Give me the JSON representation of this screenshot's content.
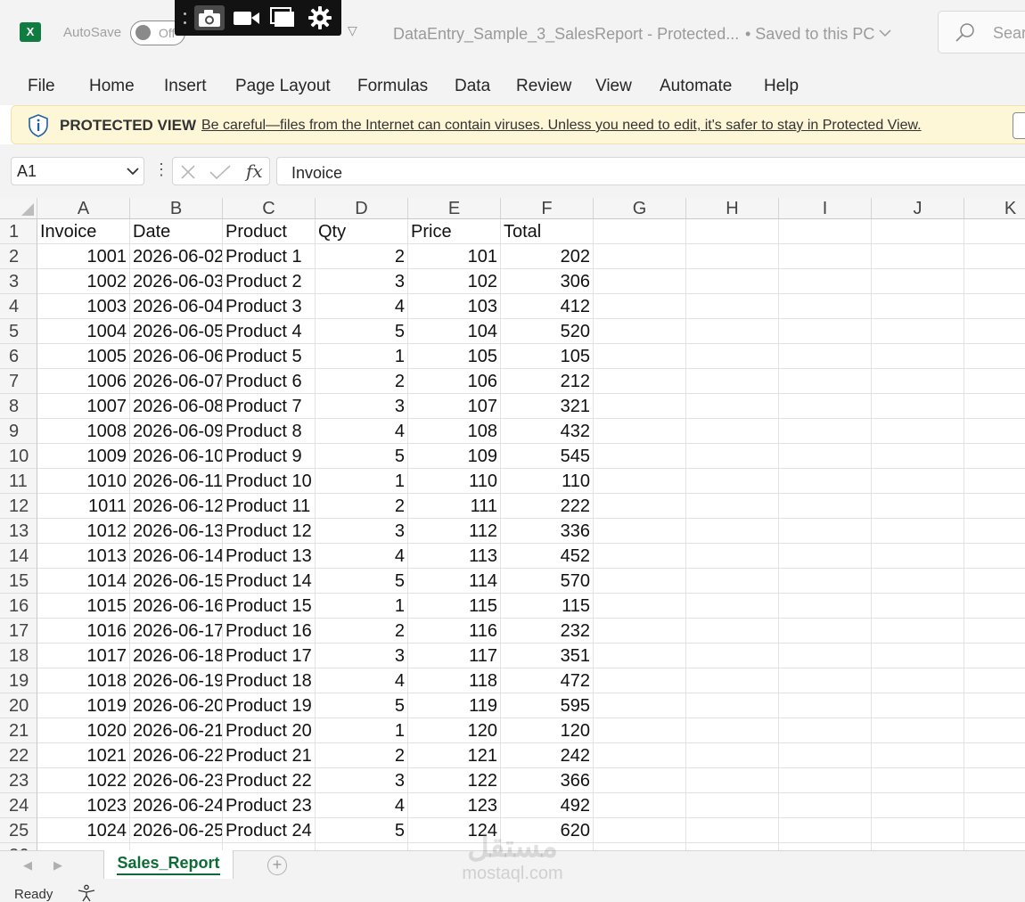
{
  "title_bar": {
    "app_logo_letter": "X",
    "autosave_label": "AutoSave",
    "autosave_state": "Off",
    "document_title": "DataEntry_Sample_3_SalesReport  -  Protected...",
    "save_status": "• Saved to this PC",
    "search_placeholder": "Search"
  },
  "menu": [
    "File",
    "Home",
    "Insert",
    "Page Layout",
    "Formulas",
    "Data",
    "Review",
    "View",
    "Automate",
    "Help"
  ],
  "protected_view": {
    "title": "PROTECTED VIEW",
    "message": "Be careful—files from the Internet can contain viruses. Unless you need to edit, it's safer to stay in Protected View."
  },
  "formula_bar": {
    "name_box": "A1",
    "fx_label": "fx",
    "formula": "Invoice"
  },
  "grid": {
    "columns": [
      "A",
      "B",
      "C",
      "D",
      "E",
      "F",
      "G",
      "H",
      "I",
      "J",
      "K"
    ],
    "header_row": [
      "Invoice",
      "Date",
      "Product",
      "Qty",
      "Price",
      "Total"
    ],
    "rows": [
      [
        "1001",
        "2026-06-02",
        "Product 1",
        "2",
        "101",
        "202"
      ],
      [
        "1002",
        "2026-06-03",
        "Product 2",
        "3",
        "102",
        "306"
      ],
      [
        "1003",
        "2026-06-04",
        "Product 3",
        "4",
        "103",
        "412"
      ],
      [
        "1004",
        "2026-06-05",
        "Product 4",
        "5",
        "104",
        "520"
      ],
      [
        "1005",
        "2026-06-06",
        "Product 5",
        "1",
        "105",
        "105"
      ],
      [
        "1006",
        "2026-06-07",
        "Product 6",
        "2",
        "106",
        "212"
      ],
      [
        "1007",
        "2026-06-08",
        "Product 7",
        "3",
        "107",
        "321"
      ],
      [
        "1008",
        "2026-06-09",
        "Product 8",
        "4",
        "108",
        "432"
      ],
      [
        "1009",
        "2026-06-10",
        "Product 9",
        "5",
        "109",
        "545"
      ],
      [
        "1010",
        "2026-06-11",
        "Product 10",
        "1",
        "110",
        "110"
      ],
      [
        "1011",
        "2026-06-12",
        "Product 11",
        "2",
        "111",
        "222"
      ],
      [
        "1012",
        "2026-06-13",
        "Product 12",
        "3",
        "112",
        "336"
      ],
      [
        "1013",
        "2026-06-14",
        "Product 13",
        "4",
        "113",
        "452"
      ],
      [
        "1014",
        "2026-06-15",
        "Product 14",
        "5",
        "114",
        "570"
      ],
      [
        "1015",
        "2026-06-16",
        "Product 15",
        "1",
        "115",
        "115"
      ],
      [
        "1016",
        "2026-06-17",
        "Product 16",
        "2",
        "116",
        "232"
      ],
      [
        "1017",
        "2026-06-18",
        "Product 17",
        "3",
        "117",
        "351"
      ],
      [
        "1018",
        "2026-06-19",
        "Product 18",
        "4",
        "118",
        "472"
      ],
      [
        "1019",
        "2026-06-20",
        "Product 19",
        "5",
        "119",
        "595"
      ],
      [
        "1020",
        "2026-06-21",
        "Product 20",
        "1",
        "120",
        "120"
      ],
      [
        "1021",
        "2026-06-22",
        "Product 21",
        "2",
        "121",
        "242"
      ],
      [
        "1022",
        "2026-06-23",
        "Product 22",
        "3",
        "122",
        "366"
      ],
      [
        "1023",
        "2026-06-24",
        "Product 23",
        "4",
        "123",
        "492"
      ],
      [
        "1024",
        "2026-06-25",
        "Product 24",
        "5",
        "124",
        "620"
      ]
    ]
  },
  "sheets": {
    "active": "Sales_Report"
  },
  "status": {
    "ready": "Ready"
  },
  "watermark": {
    "logo": "مستقل",
    "text": "mostaql.com"
  },
  "colors": {
    "excel_green": "#107c41",
    "sheet_tab_green": "#0e6b36",
    "protected_banner": "#fdf7d7",
    "chrome_bg": "#f3f3f3"
  }
}
